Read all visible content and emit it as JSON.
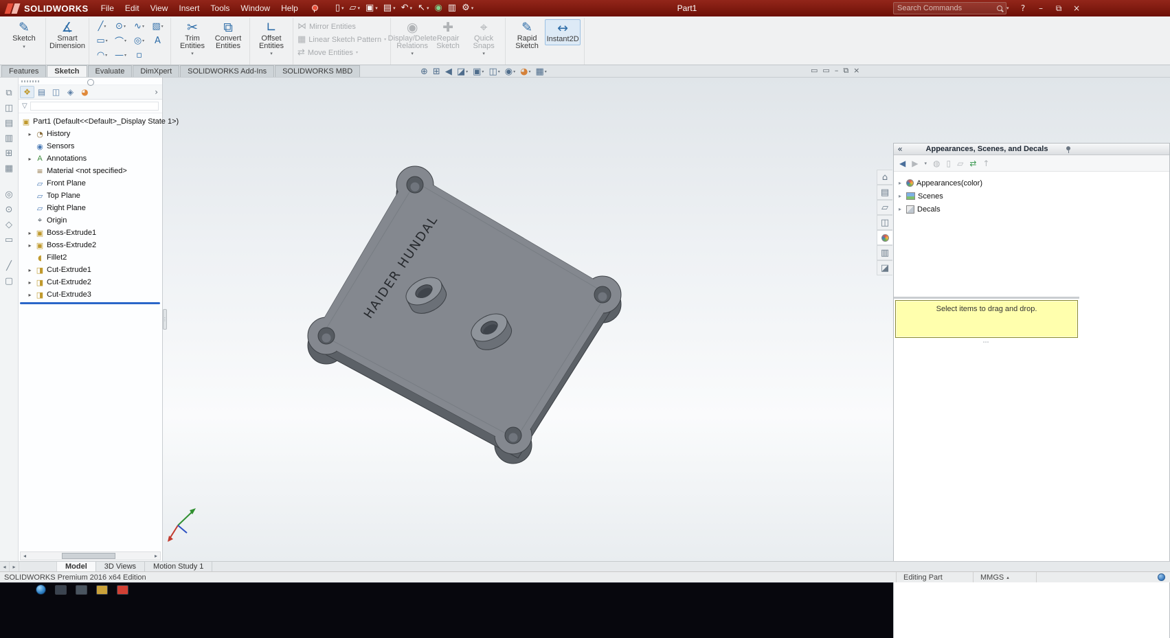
{
  "glyphs": {
    "caret": "▾",
    "caret_up": "▴",
    "expand": "▸",
    "chevron": "›",
    "collapse": "«",
    "dots": "⋯",
    "splitter": "⋮",
    "scroll_left": "◂",
    "scroll_right": "▸",
    "minimize": "–",
    "restore": "⧉",
    "close": "×",
    "help": "?",
    "funnel": "▽"
  },
  "titlebar": {
    "brand": "SOLIDWORKS",
    "menus": [
      "File",
      "Edit",
      "View",
      "Insert",
      "Tools",
      "Window",
      "Help"
    ],
    "qat": [
      {
        "name": "new-document",
        "glyph": "▯"
      },
      {
        "name": "open-document",
        "glyph": "▱"
      },
      {
        "name": "save",
        "glyph": "▣"
      },
      {
        "name": "print",
        "glyph": "▤"
      },
      {
        "name": "undo",
        "glyph": "↶"
      },
      {
        "name": "select",
        "glyph": "↖"
      },
      {
        "name": "rebuild",
        "glyph": "◉"
      },
      {
        "name": "file-properties",
        "glyph": "▥"
      },
      {
        "name": "options",
        "glyph": "⚙"
      }
    ],
    "doc_title": "Part1",
    "search_placeholder": "Search Commands"
  },
  "ribbon": {
    "tabs": [
      "Features",
      "Sketch",
      "Evaluate",
      "DimXpert",
      "SOLIDWORKS Add-Ins",
      "SOLIDWORKS MBD"
    ],
    "labels": {
      "sketch": "Sketch",
      "smart_dimension": "Smart Dimension",
      "trim": "Trim Entities",
      "convert": "Convert Entities",
      "offset": "Offset Entities",
      "mirror": "Mirror Entities",
      "linear": "Linear Sketch Pattern",
      "move": "Move Entities",
      "display_delete": "Display/Delete Relations",
      "repair": "Repair Sketch",
      "quick": "Quick Snaps",
      "rapid": "Rapid Sketch",
      "instant": "Instant2D"
    },
    "icons": {
      "sketch": "✎",
      "smart_dimension": "∡",
      "trim": "✂",
      "convert": "⧉",
      "offset": "∟",
      "mirror": "⋈",
      "linear": "▦",
      "move": "⇄",
      "display_delete": "◉",
      "repair": "✚",
      "quick": "⌖",
      "rapid": "✎",
      "instant": "↔"
    },
    "tools": [
      "╱",
      "⊙",
      "∿",
      "▧",
      "▭",
      "⌒",
      "◎",
      "A",
      "◠",
      "—",
      "▫"
    ]
  },
  "leftstrip": [
    "⧉",
    "◫",
    "▤",
    "▥",
    "⊞",
    "▦",
    "◎",
    "⊙",
    "◇",
    "▭",
    "╱",
    "▢"
  ],
  "fm": {
    "tabs": [
      "❖",
      "▤",
      "◫",
      "◈",
      "◕"
    ],
    "root_glyph": "▣",
    "root_label": "Part1 (Default<<Default>_Display State 1>)",
    "items": [
      {
        "label": "History",
        "glyph": "◔"
      },
      {
        "label": "Sensors",
        "glyph": "◉"
      },
      {
        "label": "Annotations",
        "glyph": "A"
      },
      {
        "label": "Material <not specified>",
        "glyph": "≡"
      },
      {
        "label": "Front Plane",
        "glyph": "▱"
      },
      {
        "label": "Top Plane",
        "glyph": "▱"
      },
      {
        "label": "Right Plane",
        "glyph": "▱"
      },
      {
        "label": "Origin",
        "glyph": "⌖"
      },
      {
        "label": "Boss-Extrude1",
        "glyph": "▣"
      },
      {
        "label": "Boss-Extrude2",
        "glyph": "▣"
      },
      {
        "label": "Fillet2",
        "glyph": "◖"
      },
      {
        "label": "Cut-Extrude1",
        "glyph": "◨"
      },
      {
        "label": "Cut-Extrude2",
        "glyph": "◨"
      },
      {
        "label": "Cut-Extrude3",
        "glyph": "◨"
      }
    ]
  },
  "viewport": {
    "part_text": "HAIDER HUNDAL",
    "hud": [
      {
        "name": "zoom-fit",
        "glyph": "⊕"
      },
      {
        "name": "zoom-area",
        "glyph": "⊞"
      },
      {
        "name": "previous-view",
        "glyph": "◀"
      },
      {
        "name": "section-view",
        "glyph": "◪"
      },
      {
        "name": "view-orientation",
        "glyph": "▣"
      },
      {
        "name": "display-style",
        "glyph": "◫"
      },
      {
        "name": "hide-show-items",
        "glyph": "◉"
      },
      {
        "name": "edit-appearance",
        "glyph": "◕"
      },
      {
        "name": "view-settings",
        "glyph": "▦"
      }
    ],
    "mdi": [
      "▭",
      "▭",
      "–",
      "⧉",
      "×"
    ]
  },
  "task_pane": {
    "title": "Appearances, Scenes, and Decals",
    "toolbar": [
      "◀",
      "▶",
      "▾",
      "◍",
      "▯",
      "▱",
      "⇄",
      "↑"
    ],
    "tree": [
      {
        "label": "Appearances(color)"
      },
      {
        "label": "Scenes"
      },
      {
        "label": "Decals"
      }
    ],
    "message": "Select items to drag and drop.",
    "tabs_glyphs": [
      "⌂",
      "▤",
      "▱",
      "◫",
      "",
      "▥",
      "◪"
    ]
  },
  "doc_tabs": {
    "nav": [
      "◂",
      "▸"
    ],
    "tabs": [
      "Model",
      "3D Views",
      "Motion Study 1"
    ]
  },
  "status_bar": {
    "left": "SOLIDWORKS Premium 2016 x64 Edition",
    "editing": "Editing Part",
    "units": "MMGS"
  }
}
